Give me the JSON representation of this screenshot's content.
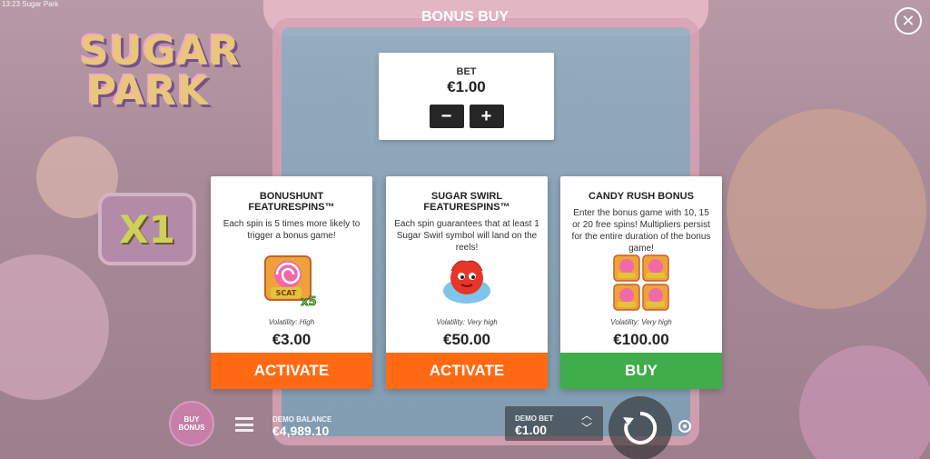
{
  "window": {
    "title": "13:23 Sugar Park"
  },
  "logo": {
    "line1": "SUGAR",
    "line2": "PARK"
  },
  "multiplier": "X1",
  "overlay": {
    "title": "BONUS BUY",
    "close_icon": "close-icon"
  },
  "bet": {
    "label": "BET",
    "value": "€1.00",
    "decrease": "−",
    "increase": "+"
  },
  "cards": [
    {
      "title": "BONUSHUNT FEATURESPINS™",
      "description": "Each spin is 5 times more likely to trigger a bonus game!",
      "image_icon": "scatter-x5-icon",
      "volatility": "Volatility: High",
      "price": "€3.00",
      "action": "ACTIVATE",
      "action_color": "#ff6a13"
    },
    {
      "title": "SUGAR SWIRL FEATURESPINS™",
      "description": "Each spin guarantees that at least 1 Sugar Swirl symbol will land on the reels!",
      "image_icon": "sugar-swirl-icon",
      "volatility": "Volatility: Very high",
      "price": "€50.00",
      "action": "ACTIVATE",
      "action_color": "#ff6a13"
    },
    {
      "title": "CANDY RUSH BONUS",
      "description": "Enter the bonus game with 10, 15 or 20 free spins! Multipliers persist for the entire duration of the bonus game!",
      "image_icon": "four-scatters-icon",
      "volatility": "Volatility: Very high",
      "price": "€100.00",
      "action": "BUY",
      "action_color": "#3fad49"
    }
  ],
  "hud": {
    "buy_bonus_label": "BUY BONUS",
    "balance_label": "DEMO BALANCE",
    "balance_value": "€4,989.10",
    "demo_bet_label": "DEMO BET",
    "demo_bet_value": "€1.00"
  }
}
